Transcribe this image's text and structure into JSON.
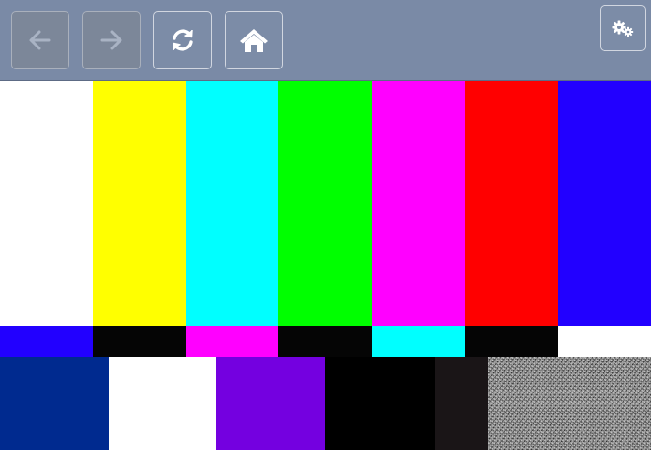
{
  "toolbar": {
    "background": "#7a8aa6",
    "buttons": [
      {
        "name": "back",
        "icon": "arrow-left-icon",
        "enabled": false
      },
      {
        "name": "forward",
        "icon": "arrow-right-icon",
        "enabled": false
      },
      {
        "name": "reload",
        "icon": "refresh-icon",
        "enabled": true
      },
      {
        "name": "home",
        "icon": "home-icon",
        "enabled": true
      },
      {
        "name": "settings",
        "icon": "gears-icon",
        "enabled": true
      }
    ]
  },
  "test_pattern": {
    "upper_bars": [
      "#ffffff",
      "#ffff00",
      "#00ffff",
      "#00ff00",
      "#ff00ff",
      "#ff0000",
      "#2200ff"
    ],
    "middle_bars": [
      "#2200ff",
      "#050505",
      "#ff00ff",
      "#050505",
      "#00ffff",
      "#050505",
      "#ffffff"
    ],
    "lower_bars": [
      "#002a8f",
      "#ffffff",
      "#7400e0",
      "#000000",
      "#000000",
      "#1a1517",
      "noise"
    ]
  }
}
